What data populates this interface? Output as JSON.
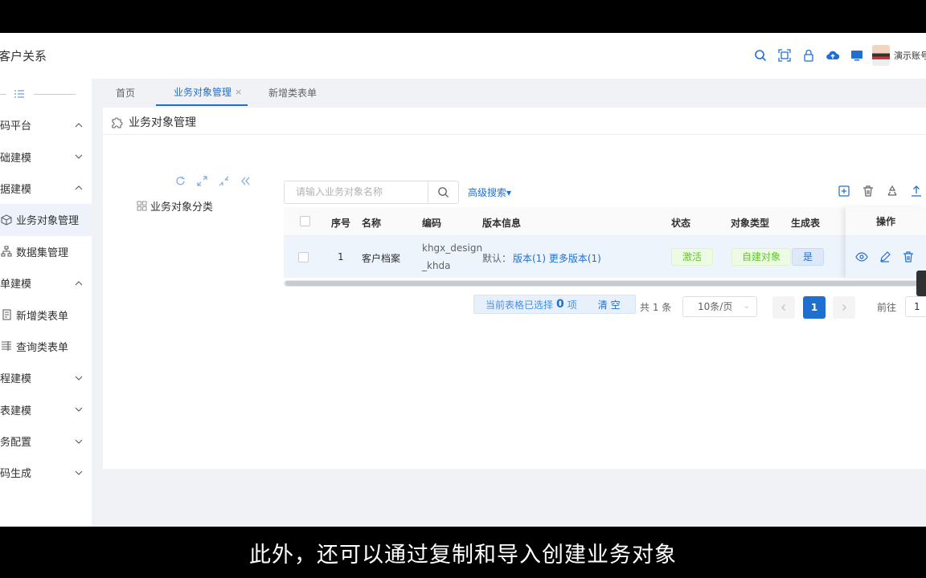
{
  "header": {
    "app_title": "客户关系",
    "user_name": "演示账号",
    "icons": [
      "search-icon",
      "fullscreen-icon",
      "lock-icon",
      "cloud-upload-icon",
      "monitor-icon"
    ]
  },
  "sidebar": {
    "items": [
      {
        "label": "码平台",
        "type": "group",
        "expanded": true
      },
      {
        "label": "础建模",
        "type": "group",
        "expanded": false
      },
      {
        "label": "据建模",
        "type": "group",
        "expanded": true
      },
      {
        "label": "业务对象管理",
        "type": "sub",
        "icon": "cube-icon",
        "active": true
      },
      {
        "label": "数据集管理",
        "type": "sub",
        "icon": "dataset-icon"
      },
      {
        "label": "单建模",
        "type": "group",
        "expanded": true
      },
      {
        "label": "新增类表单",
        "type": "sub",
        "icon": "form-add-icon"
      },
      {
        "label": "查询类表单",
        "type": "sub",
        "icon": "form-query-icon"
      },
      {
        "label": "程建模",
        "type": "group",
        "expanded": false
      },
      {
        "label": "表建模",
        "type": "group",
        "expanded": false
      },
      {
        "label": "务配置",
        "type": "group",
        "expanded": false
      },
      {
        "label": "码生成",
        "type": "group",
        "expanded": false
      }
    ]
  },
  "tabs": [
    {
      "label": "首页"
    },
    {
      "label": "业务对象管理",
      "active": true,
      "close": "×"
    },
    {
      "label": "新增类表单"
    }
  ],
  "page": {
    "title": "业务对象管理",
    "tree_root": "业务对象分类",
    "search_placeholder": "请输入业务对象名称",
    "advanced_search": "高级搜索▾"
  },
  "table": {
    "columns": [
      "序号",
      "名称",
      "编码",
      "版本信息",
      "状态",
      "对象类型",
      "生成表",
      "操作"
    ],
    "rows": [
      {
        "index": "1",
        "name": "客户档案",
        "code_line1": "khgx_design",
        "code_line2": "_khda",
        "version_prefix": "默认：",
        "version_link": "版本(1) 更多版本(1)",
        "status": "激活",
        "object_type": "自建对象",
        "generated_table": "是"
      }
    ]
  },
  "pagination": {
    "selected_prefix": "当前表格已选择",
    "selected_count": "0",
    "selected_suffix": "项",
    "clear": "清 空",
    "total": "共 1 条",
    "page_size": "10条/页",
    "current_page": "1",
    "goto_label": "前往",
    "goto_value": "1"
  },
  "subtitle": "此外，还可以通过复制和导入创建业务对象",
  "colors": {
    "accent": "#1f6fd1",
    "success": "#67c23a",
    "background": "#f0f2f5"
  }
}
